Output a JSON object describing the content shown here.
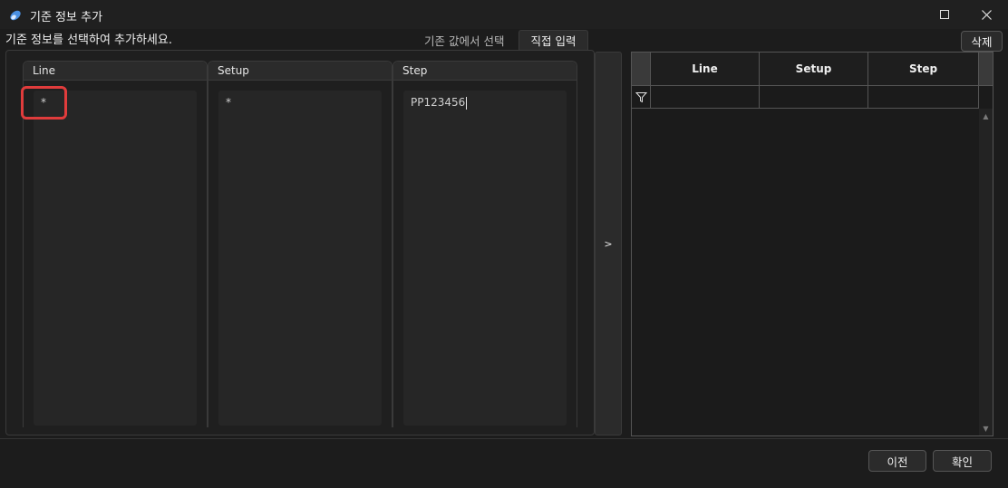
{
  "window": {
    "title": "기준 정보 추가",
    "app_icon": "app-logo-icon"
  },
  "instruction": "기준 정보를 선택하여 추가하세요.",
  "tabs": [
    {
      "label": "기존 값에서 선택",
      "active": false
    },
    {
      "label": "직접 입력",
      "active": true
    }
  ],
  "delete_label": "삭제",
  "columns": [
    {
      "header": "Line",
      "value": "*"
    },
    {
      "header": "Setup",
      "value": "*"
    },
    {
      "header": "Step",
      "value": "PP123456"
    }
  ],
  "move_label": ">",
  "grid": {
    "headers": [
      "Line",
      "Setup",
      "Step"
    ],
    "filter_icon": "filter-icon"
  },
  "footer": {
    "prev_label": "이전",
    "ok_label": "확인"
  },
  "colors": {
    "highlight": "#e03c3c",
    "background": "#1c1c1c"
  }
}
